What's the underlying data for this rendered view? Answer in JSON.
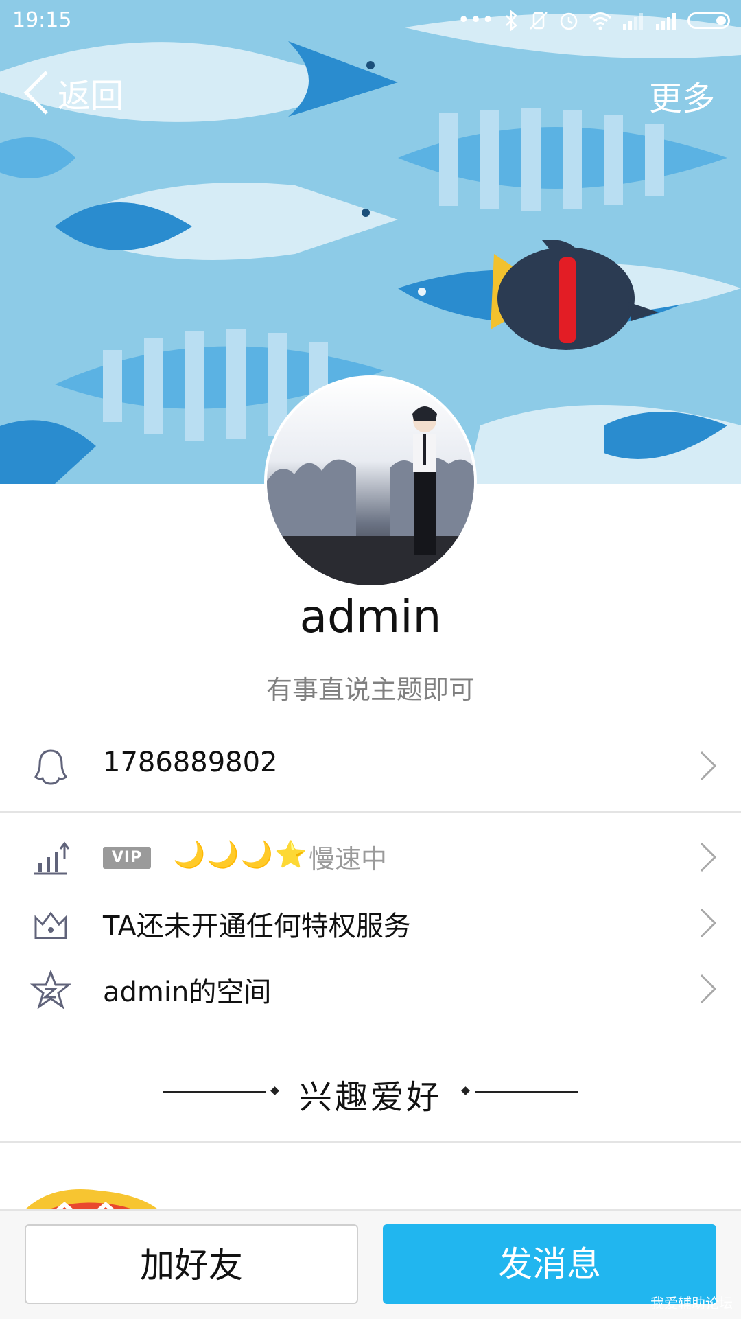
{
  "status_bar": {
    "time": "19:15",
    "icons": [
      "more-dots-icon",
      "bluetooth-icon",
      "vibrate-off-icon",
      "alarm-icon",
      "wifi-icon",
      "signal-icon",
      "signal-icon",
      "battery-icon"
    ]
  },
  "nav": {
    "back_label": "返回",
    "more_label": "更多"
  },
  "profile": {
    "name": "admin",
    "signature": "有事直说主题即可"
  },
  "info": {
    "qq_number": "1786889802",
    "vip_badge": "VIP",
    "level_icons": "🌙🌙🌙⭐",
    "level_status": "慢速中",
    "privilege_text": "TA还未开通任何特权服务",
    "space_text": "admin的空间"
  },
  "interests": {
    "title": "兴趣爱好"
  },
  "actions": {
    "add_friend": "加好友",
    "send_message": "发消息"
  },
  "watermark": "我爱辅助论坛",
  "colors": {
    "accent": "#21b6ef",
    "cover_bg": "#8dcbe7",
    "text_primary": "#111111",
    "text_secondary": "#808080"
  }
}
